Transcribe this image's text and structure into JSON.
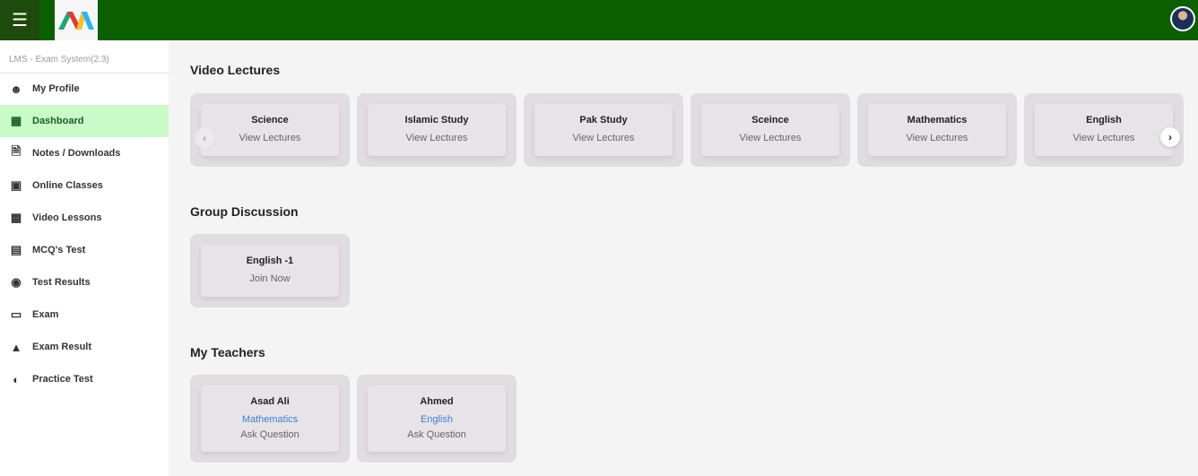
{
  "header": {
    "menu_icon": "hamburger-icon",
    "logo_text": "M",
    "avatar": "user-avatar"
  },
  "sidebar": {
    "title": "LMS - Exam System(2.3)",
    "items": [
      {
        "label": "My Profile",
        "icon": "user-icon",
        "active": false
      },
      {
        "label": "Dashboard",
        "icon": "grid-icon",
        "active": true
      },
      {
        "label": "Notes / Downloads",
        "icon": "document-icon",
        "active": false
      },
      {
        "label": "Online Classes",
        "icon": "classroom-icon",
        "active": false
      },
      {
        "label": "Video Lessons",
        "icon": "video-icon",
        "active": false
      },
      {
        "label": "MCQ's Test",
        "icon": "presentation-icon",
        "active": false
      },
      {
        "label": "Test Results",
        "icon": "medal-icon",
        "active": false
      },
      {
        "label": "Exam",
        "icon": "clipboard-icon",
        "active": false
      },
      {
        "label": "Exam Result",
        "icon": "podium-icon",
        "active": false
      },
      {
        "label": "Practice Test",
        "icon": "speedometer-icon",
        "active": false
      }
    ]
  },
  "video_lectures": {
    "title": "Video Lectures",
    "cards": [
      {
        "title": "Science",
        "action": "View Lectures"
      },
      {
        "title": "Islamic Study",
        "action": "View Lectures"
      },
      {
        "title": "Pak Study",
        "action": "View Lectures"
      },
      {
        "title": "Sceince",
        "action": "View Lectures"
      },
      {
        "title": "Mathematics",
        "action": "View Lectures"
      },
      {
        "title": "English",
        "action": "View Lectures"
      }
    ]
  },
  "group_discussion": {
    "title": "Group Discussion",
    "cards": [
      {
        "title": "English -1",
        "action": "Join Now"
      }
    ]
  },
  "teachers": {
    "title": "My Teachers",
    "cards": [
      {
        "name": "Asad Ali",
        "subject": "Mathematics",
        "action": "Ask Question"
      },
      {
        "name": "Ahmed",
        "subject": "English",
        "action": "Ask Question"
      }
    ]
  },
  "colors": {
    "header": "#0b5f00",
    "active_bg": "#c9fbc9",
    "link": "#3f7fd0"
  }
}
